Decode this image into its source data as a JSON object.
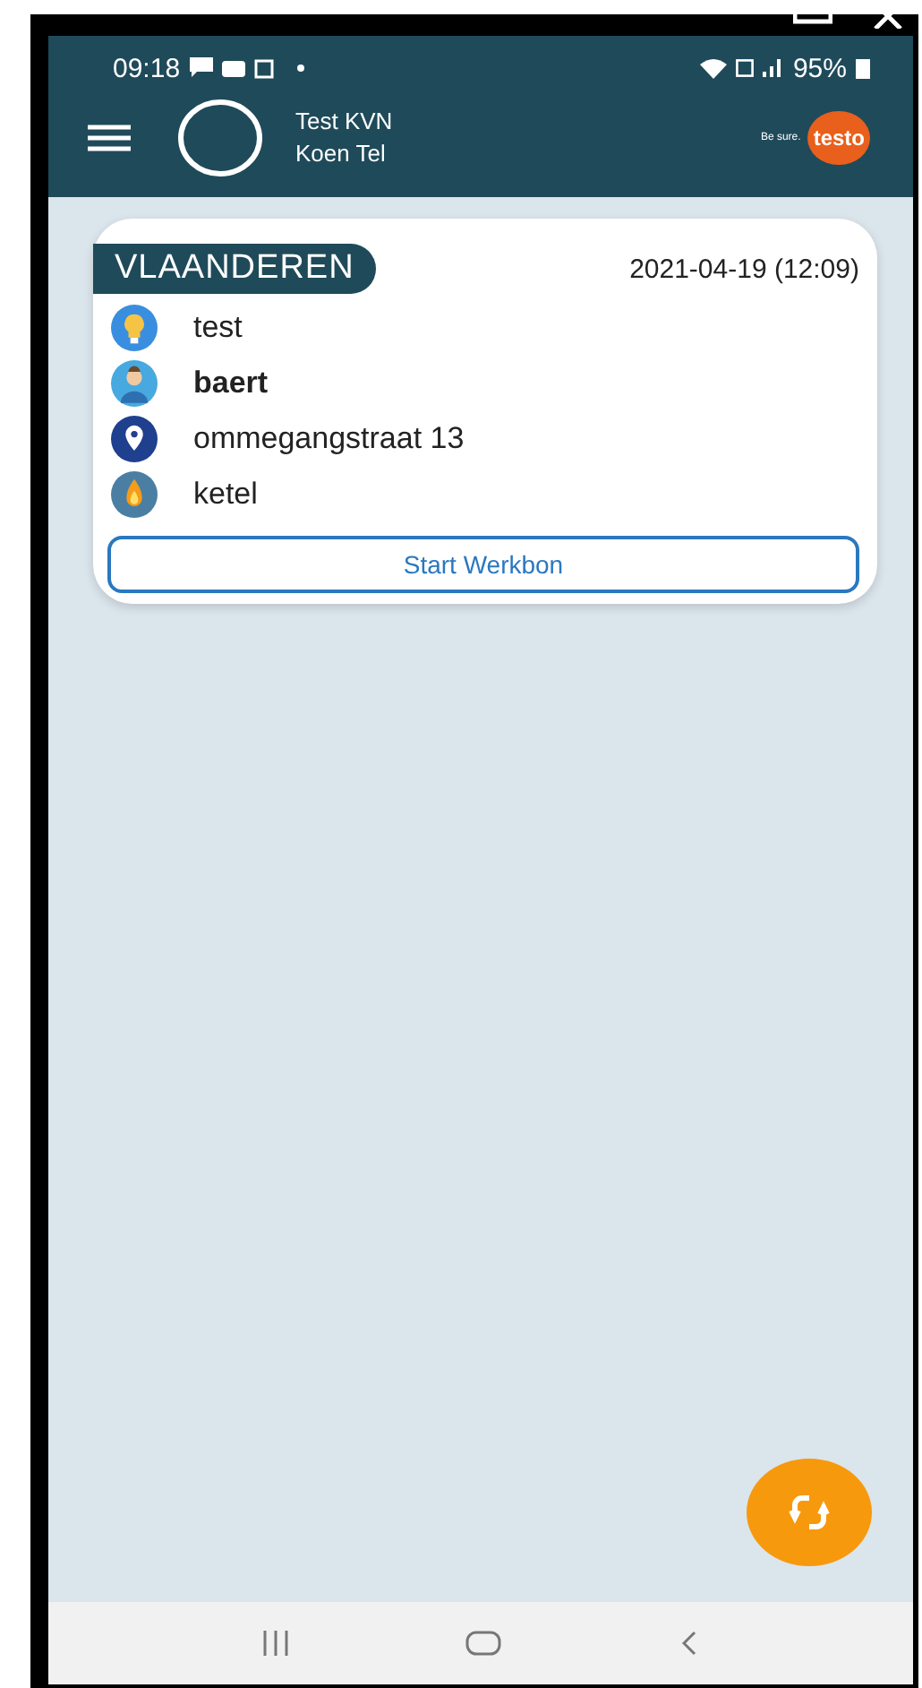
{
  "status_bar": {
    "time": "09:18",
    "battery": "95%"
  },
  "app_bar": {
    "line_1": "Test KVN",
    "line_2": "Koen Tel",
    "brand_tagline": "Be sure.",
    "brand_logo": "testo"
  },
  "card": {
    "region": "VLAANDEREN",
    "date": "2021-04-19 (12:09)",
    "rows": [
      {
        "kind": "bulb",
        "text": "test",
        "bold": false
      },
      {
        "kind": "person",
        "text": "baert",
        "bold": true
      },
      {
        "kind": "pin",
        "text": "ommegangstraat 13",
        "bold": false
      },
      {
        "kind": "flame",
        "text": "ketel",
        "bold": false
      }
    ],
    "button": "Start Werkbon"
  }
}
